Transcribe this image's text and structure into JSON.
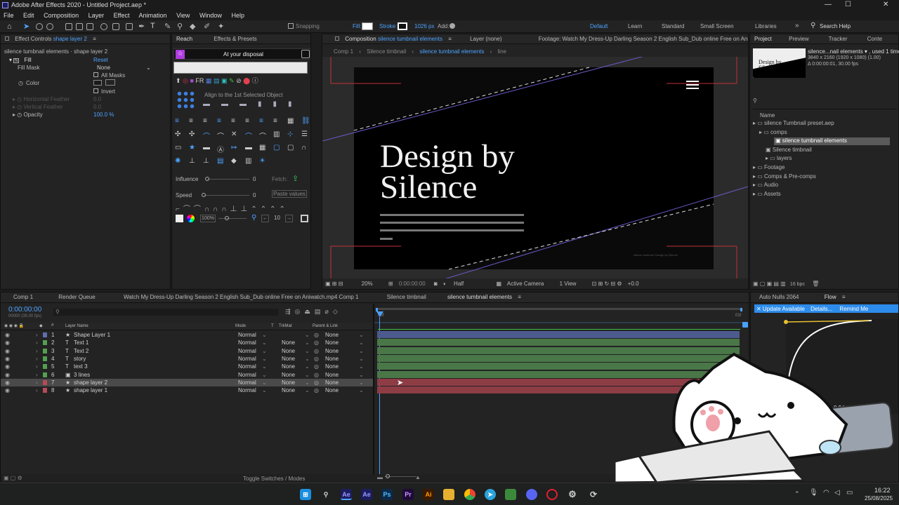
{
  "app": {
    "title": "Adobe After Effects 2020 - Untitled Project.aep *",
    "menu": [
      "File",
      "Edit",
      "Composition",
      "Layer",
      "Effect",
      "Animation",
      "View",
      "Window",
      "Help"
    ]
  },
  "toolbar": {
    "snapping": "Snapping",
    "fill": "Fill:",
    "stroke": "Stroke:",
    "stroke_px": "1026 px",
    "add": "Add:",
    "workspaces": [
      "Default",
      "Learn",
      "Standard",
      "Small Screen",
      "Libraries"
    ],
    "search": "Search Help"
  },
  "effect_controls": {
    "tab": "Effect Controls",
    "tab_target": "shape layer 2",
    "breadcrumb": "silence tumbnail elements · shape layer 2",
    "fx_name": "Fill",
    "reset": "Reset",
    "fill_mask_label": "Fill Mask",
    "fill_mask_value": "None",
    "all_masks": "All Masks",
    "color": "Color",
    "invert": "Invert",
    "h_feather": "Horizontal Feather",
    "h_feather_val": "0.0",
    "v_feather": "Vertical Feather",
    "v_feather_val": "0.0",
    "opacity": "Opacity",
    "opacity_val": "100.0 %"
  },
  "reach": {
    "tabs": [
      "Reach",
      "Effects & Presets"
    ],
    "banner": "At your disposal",
    "align_to": "Align to the 1st Selected Object",
    "influence": "Influence",
    "influence_val": "0",
    "fetch": "Fetch:",
    "speed": "Speed",
    "speed_val": "0",
    "paste_values": "Paste values",
    "pct": "100%",
    "ten": "10"
  },
  "composition": {
    "tab_prefix": "Composition",
    "tab_name": "silence tumbnail elements",
    "layer_tab": "Layer (none)",
    "footage_tab": "Footage: Watch My Dress-Up Darling Season 2 English Sub_Dub online Free on Aniwatch",
    "nav": [
      "Comp 1",
      "Silence timbnail",
      "silence tumbnail elements",
      "line"
    ],
    "headline_1": "Design by",
    "headline_2": "Silence",
    "fine_text": "silence tumbnail, Design by Silence",
    "zoom": "20%",
    "timecode": "0:00:00:00",
    "resolution": "Half",
    "camera": "Active Camera",
    "views": "1 View",
    "exposure": "+0.0"
  },
  "project": {
    "tabs": [
      "Project",
      "Preview",
      "Tracker",
      "Conte"
    ],
    "thumb_text_1": "Design by",
    "thumb_text_2": "Silence",
    "item_name": "silence...nail elements ▾ , used 1 time",
    "item_dims": "3840 x 2160  (1920 x 1080) (1.00)",
    "item_dur": "Δ 0:00:00:01, 30.00 fps",
    "col_name": "Name",
    "tree": [
      {
        "label": "silence Tumbnail preset.aep",
        "indent": 0,
        "type": "folder"
      },
      {
        "label": "comps",
        "indent": 1,
        "type": "folder"
      },
      {
        "label": "silence tumbnail elements",
        "indent": 2,
        "type": "comp",
        "selected": true
      },
      {
        "label": "Silence timbnail",
        "indent": 2,
        "type": "comp"
      },
      {
        "label": "layers",
        "indent": 2,
        "type": "folder"
      },
      {
        "label": "Footage",
        "indent": 0,
        "type": "folder"
      },
      {
        "label": "Comps & Pre-comps",
        "indent": 0,
        "type": "folder"
      },
      {
        "label": "Audio",
        "indent": 0,
        "type": "folder"
      },
      {
        "label": "Assets",
        "indent": 0,
        "type": "folder"
      }
    ],
    "bpc": "16 bpc"
  },
  "timeline": {
    "tabs": [
      "Comp 1",
      "Render Queue",
      "Watch My Dress-Up Darling Season 2 English Sub_Dub online Free on Aniwatch.mp4 Comp 1",
      "Silence timbnail",
      "silence tumbnail elements"
    ],
    "timecode": "0:00:00:00",
    "fps": "00000 (30.00 fps)",
    "cols": {
      "name": "Layer Name",
      "mode": "Mode",
      "t": "T",
      "trkmat": "TrkMat",
      "parent": "Parent & Link"
    },
    "ruler_start": "00f",
    "ruler_end": "01f",
    "toggle": "Toggle Switches / Modes",
    "layers": [
      {
        "num": "1",
        "icon": "★",
        "name": "Shape Layer 1",
        "mode": "Normal",
        "trk": "",
        "parent": "None",
        "color": "#5f6fae",
        "bar": "#4d5a8e"
      },
      {
        "num": "2",
        "icon": "T",
        "name": "Text 1",
        "mode": "Normal",
        "trk": "None",
        "parent": "None",
        "color": "#53a04f",
        "bar": "#4a7748"
      },
      {
        "num": "3",
        "icon": "T",
        "name": "Text 2",
        "mode": "Normal",
        "trk": "None",
        "parent": "None",
        "color": "#53a04f",
        "bar": "#4a7748"
      },
      {
        "num": "4",
        "icon": "T",
        "name": "story",
        "mode": "Normal",
        "trk": "None",
        "parent": "None",
        "color": "#53a04f",
        "bar": "#4a7748"
      },
      {
        "num": "5",
        "icon": "T",
        "name": "text 3",
        "mode": "Normal",
        "trk": "None",
        "parent": "None",
        "color": "#53a04f",
        "bar": "#4a7748"
      },
      {
        "num": "6",
        "icon": "▣",
        "name": "3 lines",
        "mode": "Normal",
        "trk": "None",
        "parent": "None",
        "color": "#53a04f",
        "bar": "#4a7748"
      },
      {
        "num": "7",
        "icon": "★",
        "name": "shape layer 2",
        "mode": "Normal",
        "trk": "None",
        "parent": "None",
        "color": "#b74b57",
        "bar": "#8e3d45",
        "selected": true
      },
      {
        "num": "8",
        "icon": "★",
        "name": "shape layer 1",
        "mode": "Normal",
        "trk": "None",
        "parent": "None",
        "color": "#b74b57",
        "bar": "#8e3d45"
      }
    ]
  },
  "flow": {
    "tabs": [
      "Auto Nulls 2064",
      "Flow"
    ],
    "update": "✕ Update Available",
    "details": "Details...",
    "remind": "Remind Me",
    "value": "0.94"
  },
  "taskbar": {
    "time": "16:22",
    "date": "25/08/2025"
  },
  "colors": {
    "accent": "#2d8ceb",
    "selection": "#4da3ff",
    "timeline_playhead": "#4aa0ff"
  }
}
